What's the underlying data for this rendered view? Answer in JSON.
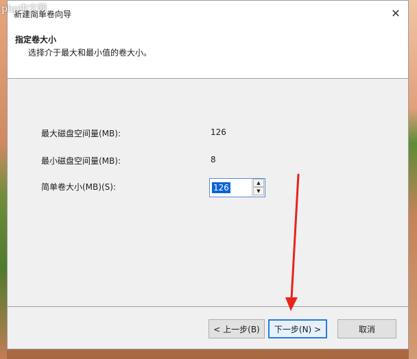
{
  "watermark": "php中文网",
  "window": {
    "title": "新建简单卷向导"
  },
  "header": {
    "title": "指定卷大小",
    "subtitle": "选择介于最大和最小值的卷大小。"
  },
  "fields": {
    "max_label": "最大磁盘空间量(MB):",
    "max_value": "126",
    "min_label": "最小磁盘空间量(MB):",
    "min_value": "8",
    "size_label": "简单卷大小(MB)(S):",
    "size_value": "126"
  },
  "buttons": {
    "back": "< 上一步(B)",
    "next": "下一步(N) >",
    "cancel": "取消"
  },
  "colors": {
    "annotation_arrow": "#e8231a",
    "selection": "#0a64d6",
    "primary_border": "#2a7be0"
  }
}
